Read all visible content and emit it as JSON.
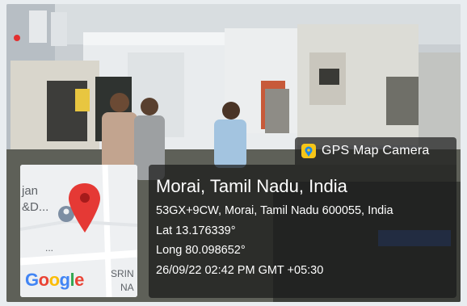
{
  "badge": {
    "title": "GPS Map Camera",
    "icon": "gps-map-camera-app-icon"
  },
  "location": {
    "place": "Morai, Tamil Nadu, India",
    "address": "53GX+9CW, Morai, Tamil Nadu 600055, India",
    "latitude": "Lat 13.176339°",
    "longitude": "Long 80.098652°",
    "timestamp": "26/09/22 02:42 PM GMT +05:30"
  },
  "map": {
    "label_top_left_1": "jan",
    "label_top_left_2": "&D...",
    "label_bottom_right_1": "SRIN",
    "label_bottom_right_2": "NA",
    "dots": "...",
    "google_letters": [
      "G",
      "o",
      "o",
      "g",
      "l",
      "e"
    ],
    "google_colors": [
      "#4285F4",
      "#EA4335",
      "#FBBC05",
      "#4285F4",
      "#34A853",
      "#EA4335"
    ],
    "pin_color": "#E53935"
  }
}
